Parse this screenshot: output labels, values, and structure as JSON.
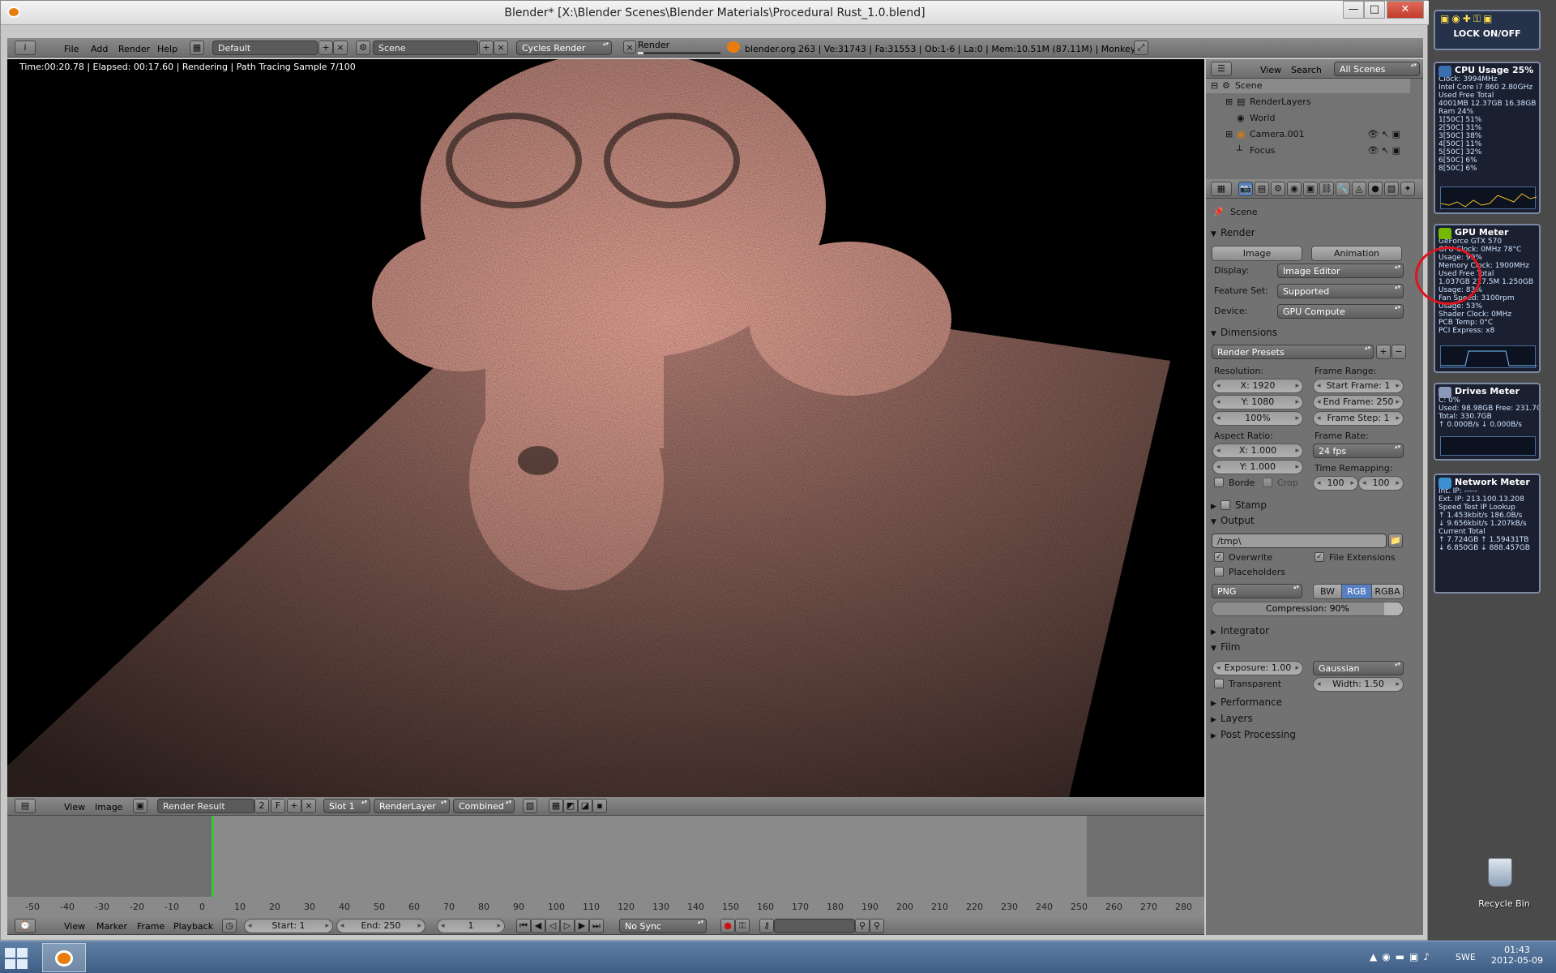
{
  "window": {
    "title": "Blender* [X:\\Blender Scenes\\Blender Materials\\Procedural Rust_1.0.blend]",
    "minimize": "—",
    "maximize": "□",
    "close": "✕"
  },
  "info_header": {
    "menus": [
      "File",
      "Add",
      "Render",
      "Help"
    ],
    "layout": "Default",
    "scene": "Scene",
    "engine": "Cycles Render",
    "render_progress_label": "Render",
    "stats": "blender.org 263 | Ve:31743 | Fa:31553 | Ob:1-6 | La:0 | Mem:10.51M (87.11M) | Monkey"
  },
  "viewport": {
    "status": "Time:00:20.78 | Elapsed: 00:17.60 | Rendering | Path Tracing Sample 7/100"
  },
  "image_header": {
    "menus": [
      "View",
      "Image"
    ],
    "image": "Render Result",
    "users": "2",
    "fake": "F",
    "slot": "Slot 1",
    "layer": "RenderLayer",
    "pass": "Combined"
  },
  "outliner": {
    "menus": [
      "View",
      "Search"
    ],
    "filter": "All Scenes",
    "items": [
      "Scene",
      "RenderLayers",
      "World",
      "Camera.001",
      "Focus"
    ]
  },
  "properties": {
    "context": "Scene",
    "render": {
      "title": "Render",
      "image_btn": "Image",
      "animation_btn": "Animation",
      "display_label": "Display:",
      "display": "Image Editor",
      "feature_label": "Feature Set:",
      "feature": "Supported",
      "device_label": "Device:",
      "device": "GPU Compute"
    },
    "dimensions": {
      "title": "Dimensions",
      "presets": "Render Presets",
      "resolution_label": "Resolution:",
      "res_x": "X: 1920",
      "res_y": "Y: 1080",
      "res_pct": "100%",
      "frame_range_label": "Frame Range:",
      "start": "Start Frame: 1",
      "end": "End Frame: 250",
      "step": "Frame Step: 1",
      "aspect_label": "Aspect Ratio:",
      "asp_x": "X: 1.000",
      "asp_y": "Y: 1.000",
      "frame_rate_label": "Frame Rate:",
      "fps": "24 fps",
      "remap_label": "Time Remapping:",
      "remap_old": "100",
      "remap_new": "100",
      "border": "Borde",
      "crop": "Crop"
    },
    "stamp": "Stamp",
    "output": {
      "title": "Output",
      "path": "/tmp\\",
      "overwrite": "Overwrite",
      "file_ext": "File Extensions",
      "placeholders": "Placeholders",
      "format": "PNG",
      "bw": "BW",
      "rgb": "RGB",
      "rgba": "RGBA",
      "compression": "Compression: 90%"
    },
    "integrator": "Integrator",
    "film": {
      "title": "Film",
      "exposure": "Exposure: 1.00",
      "filter": "Gaussian",
      "transparent": "Transparent",
      "width": "Width: 1.50"
    },
    "performance": "Performance",
    "layers": "Layers",
    "post": "Post Processing"
  },
  "timeline": {
    "ticks": [
      "-50",
      "-40",
      "-30",
      "-20",
      "-10",
      "0",
      "10",
      "20",
      "30",
      "40",
      "50",
      "60",
      "70",
      "80",
      "90",
      "100",
      "110",
      "120",
      "130",
      "140",
      "150",
      "160",
      "170",
      "180",
      "190",
      "200",
      "210",
      "220",
      "230",
      "240",
      "250",
      "260",
      "270",
      "280"
    ],
    "menus": [
      "View",
      "Marker",
      "Frame",
      "Playback"
    ],
    "start": "Start: 1",
    "end": "End: 250",
    "current": "1",
    "sync": "No Sync"
  },
  "gadgets": {
    "lock": "LOCK ON/OFF",
    "cpu": {
      "title": "CPU Usage 25%",
      "lines": [
        "Clock: 3994MHz",
        "Intel Core i7 860 2.80GHz",
        "Used   Free   Total",
        "4001MB 12.37GB 16.38GB",
        "Ram              24%",
        "1[50C]           51%",
        "2[50C]           31%",
        "3[50C]           38%",
        "4[50C]           11%",
        "5[50C]           32%",
        "6[50C]            6%",
        "8[50C]            6%"
      ]
    },
    "gpu": {
      "title": "GPU Meter",
      "lines": [
        "GeForce GTX 570",
        "GPU Clock: 0MHz       78°C",
        "Usage: 99%",
        "Memory Clock: 1900MHz",
        "Used    Free   Total",
        "1.037GB 217.5M 1.250GB",
        "Usage: 83%",
        "Fan Speed: 3100rpm",
        "Usage: 53%",
        "Shader Clock: 0MHz",
        "PCB Temp: 0°C",
        "PCI Express: x8"
      ]
    },
    "drives": {
      "title": "Drives Meter",
      "lines": [
        "C:                0%",
        "Used: 98.98GB  Free: 231.7GB",
        "Total: 330.7GB",
        "↑ 0.000B/s   ↓ 0.000B/s"
      ]
    },
    "network": {
      "title": "Network Meter",
      "lines": [
        "Int. IP: -----",
        "Ext. IP: 213.100.13.208",
        "Speed Test   IP Lookup",
        "↑ 1.453kbit/s  186.0B/s",
        "↓ 9.656kbit/s  1.207kB/s",
        "Current        Total",
        "↑ 7.724GB   ↑ 1.59431TB",
        "↓ 6.850GB   ↓ 888.457GB"
      ]
    },
    "recycle": "Recycle Bin"
  },
  "taskbar": {
    "lang": "SWE",
    "time": "01:43",
    "date": "2012-05-09"
  },
  "colors": {
    "accent_blue": "#5680c2",
    "gpu_circle": "#e0141e",
    "timeline_frame": "#3fc43f"
  }
}
